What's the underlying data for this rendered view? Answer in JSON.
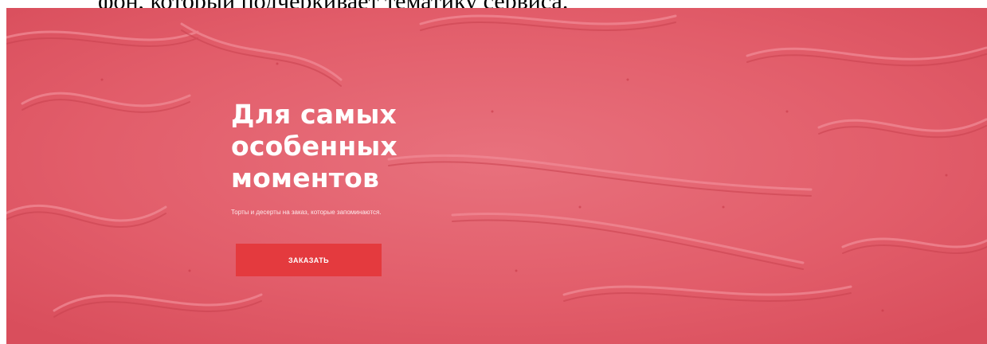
{
  "document": {
    "caption_fragment": "фон, который подчеркивает тематику сервиса."
  },
  "hero": {
    "title_lines": [
      "Для самых",
      "особенных",
      "моментов"
    ],
    "subtitle": "Торты и десерты на заказ, которые запоминаются.",
    "cta_label": "ЗАКАЗАТЬ",
    "background_image": "pink-frosting-texture"
  },
  "colors": {
    "hero_background": "#e5606d",
    "button": "#e43a3e",
    "text": "#ffffff"
  }
}
